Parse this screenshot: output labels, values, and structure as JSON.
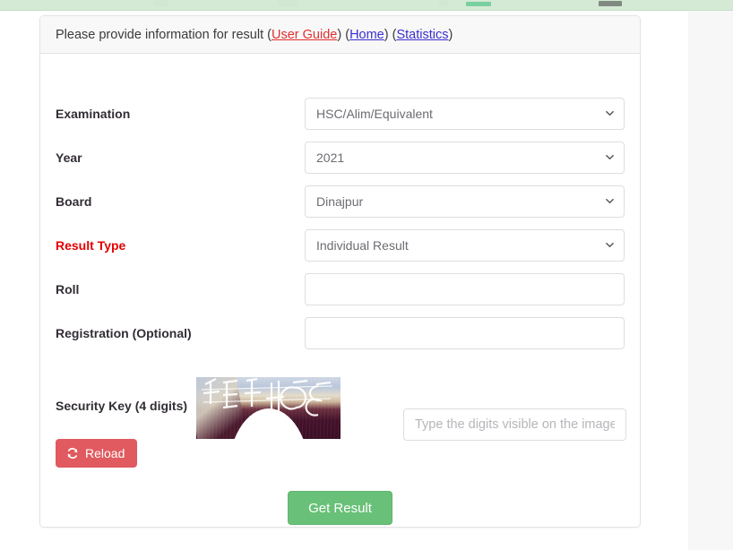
{
  "topbar": {
    "background_color": "#d5ead5"
  },
  "card": {
    "header": {
      "intro_text": "Please provide information for result ",
      "links": [
        {
          "label": "User Guide",
          "color": "#e03030"
        },
        {
          "label": "Home",
          "color": "#3b2fd0"
        },
        {
          "label": "Statistics",
          "color": "#3b2fd0"
        }
      ]
    },
    "fields": [
      {
        "label": "Examination",
        "required": false,
        "type": "select",
        "value": "HSC/Alim/Equivalent",
        "options": [
          "HSC/Alim/Equivalent"
        ]
      },
      {
        "label": "Year",
        "required": false,
        "type": "select",
        "value": "2021",
        "options": [
          "2021"
        ]
      },
      {
        "label": "Board",
        "required": false,
        "type": "select",
        "value": "Dinajpur",
        "options": [
          "Dinajpur"
        ]
      },
      {
        "label": "Result Type",
        "required": true,
        "type": "select",
        "value": "Individual Result",
        "options": [
          "Individual Result"
        ]
      },
      {
        "label": "Roll",
        "required": false,
        "type": "text",
        "value": "",
        "placeholder": ""
      },
      {
        "label": "Registration (Optional)",
        "required": false,
        "type": "text",
        "value": "",
        "placeholder": ""
      }
    ],
    "security": {
      "label": "Security Key (4 digits)",
      "captcha_digits": "4648",
      "reload_label": "Reload",
      "reload_icon": "refresh-icon",
      "reload_color": "#e05a5f",
      "input_value": "",
      "input_placeholder": "Type the digits visible on the image"
    },
    "submit": {
      "label": "Get Result",
      "color": "#69c078"
    }
  }
}
